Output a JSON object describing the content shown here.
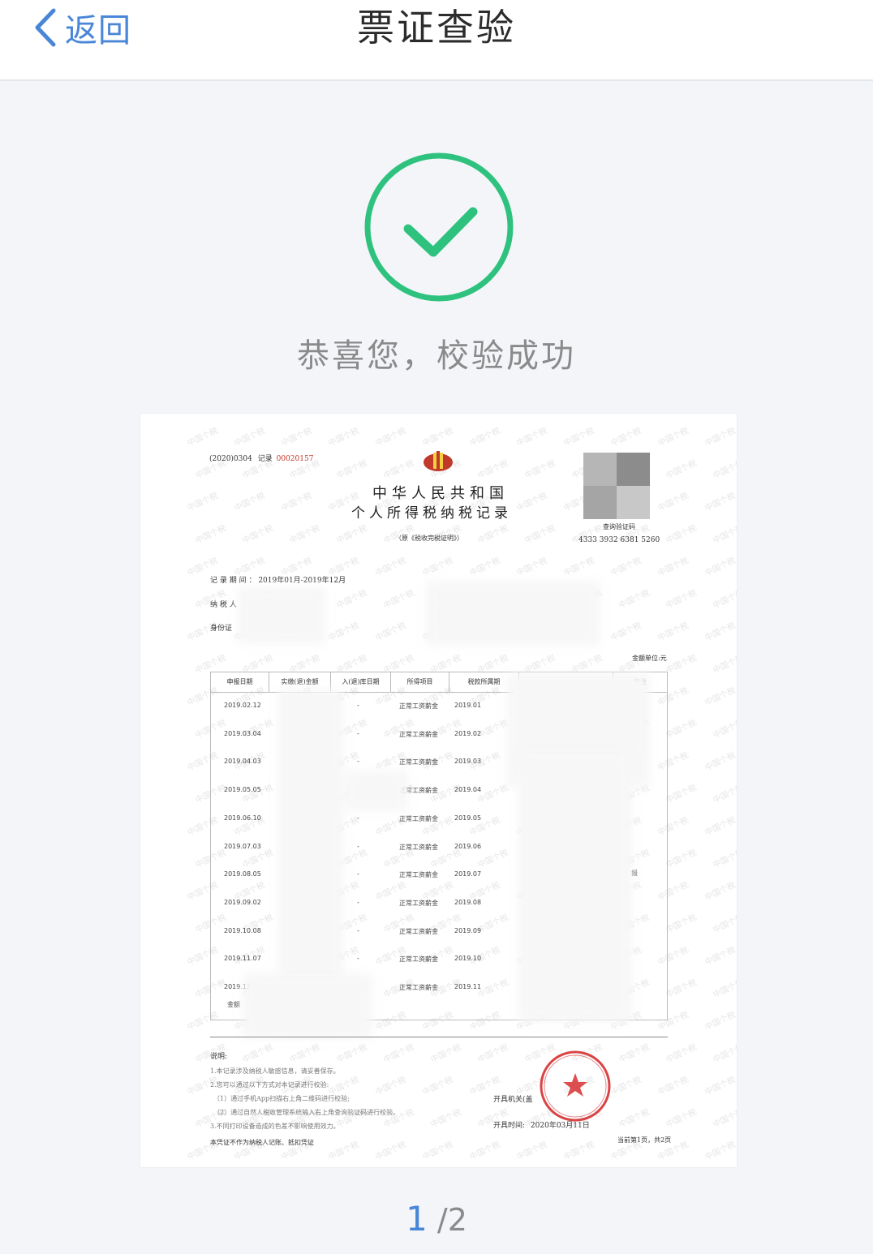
{
  "nav": {
    "back_label": "返回",
    "title": "票证查验"
  },
  "status": {
    "message": "恭喜您，校验成功",
    "icon": "check-circle-icon",
    "color": "#2ec27e"
  },
  "document": {
    "code_prefix": "(2020)0304",
    "record_label": "记录",
    "record_no": "00020157",
    "country": "中华人民共和国",
    "doc_title": "个人所得税纳税记录",
    "subtitle": "（原《税收完税证明》）",
    "query_label": "查询验证码",
    "query_code": "4333 3932 6381 5260",
    "period_label": "记 录 期 间 ：",
    "period_value": "2019年01月-2019年12月",
    "taxpayer_label": "纳 税 人",
    "id_label": "身份证",
    "unit_label": "金额单位:元",
    "table_headers": [
      "申报日期",
      "实缴(退)金额",
      "入(退)库日期",
      "所得项目",
      "税款所属期",
      "",
      "备注"
    ],
    "rows": [
      {
        "date": "2019.02.12",
        "item": "正常工资薪金",
        "period": "2019.01"
      },
      {
        "date": "2019.03.04",
        "item": "正常工资薪金",
        "period": "2019.02"
      },
      {
        "date": "2019.04.03",
        "item": "正常工资薪金",
        "period": "2019.03"
      },
      {
        "date": "2019.05.05",
        "item": "正常工资薪金",
        "period": "2019.04"
      },
      {
        "date": "2019.06.10",
        "item": "正常工资薪金",
        "period": "2019.05"
      },
      {
        "date": "2019.07.03",
        "item": "正常工资薪金",
        "period": "2019.06"
      },
      {
        "date": "2019.08.05",
        "item": "正常工资薪金",
        "period": "2019.07"
      },
      {
        "date": "2019.09.02",
        "item": "正常工资薪金",
        "period": "2019.08"
      },
      {
        "date": "2019.10.08",
        "item": "正常工资薪金",
        "period": "2019.09"
      },
      {
        "date": "2019.11.07",
        "item": "正常工资薪金",
        "period": "2019.10"
      },
      {
        "date": "2019.12",
        "item": "正常工资薪金",
        "period": "2019.11"
      }
    ],
    "row_dash": "-",
    "row_note_fragment": "报",
    "total_label": "金额",
    "notes_title": "说明:",
    "notes": [
      "1.本记录涉及纳税人敏感信息，请妥善保存。",
      "2.您可以通过以下方式对本记录进行校验:",
      "（1）通过手机App扫描右上角二维码进行校验;",
      "（2）通过自然人税收管理系统输入右上角查询验证码进行校验。",
      "3.不同打印设备造成的色差不影响使用效力。"
    ],
    "disclaimer": "本凭证不作为纳税人记账、抵扣凭证",
    "issuer_label": "开具机关(盖",
    "issue_time_label": "开具时间:",
    "issue_time_value": "2020年03月11日",
    "page_info": "当前第1页，共2页",
    "watermark": "中国个税",
    "seal_text": "国家税务总局大连市税务局",
    "seal_bottom": "业务专用章"
  },
  "pager": {
    "current": "1",
    "total": "/2"
  }
}
